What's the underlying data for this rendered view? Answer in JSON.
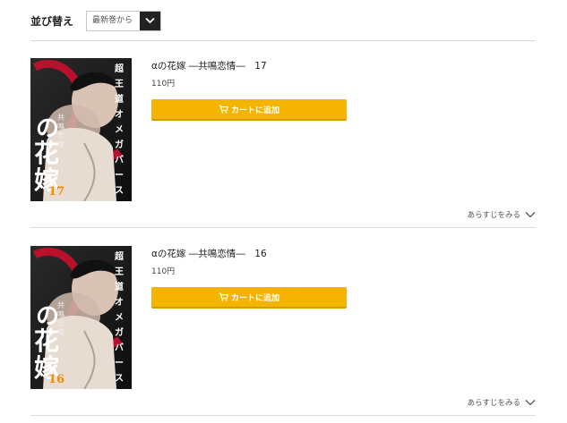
{
  "sort": {
    "label": "並び替え",
    "selected": "最新巻から"
  },
  "items": [
    {
      "title": "αの花嫁 ―共鳴恋情―　17",
      "price": "110円",
      "cart_label": "カートに追加",
      "synopsis_label": "あらすじをみる",
      "cover_volume": "17",
      "cover_title_chars": [
        "の",
        "花",
        "嫁"
      ],
      "cover_vertical_text": "超王道オメガバース",
      "cover_subtitle": "共鳴恋情"
    },
    {
      "title": "αの花嫁 ―共鳴恋情―　16",
      "price": "110円",
      "cart_label": "カートに追加",
      "synopsis_label": "あらすじをみる",
      "cover_volume": "16",
      "cover_title_chars": [
        "の",
        "花",
        "嫁"
      ],
      "cover_vertical_text": "超王道オメガバース",
      "cover_subtitle": "共鳴恋情"
    }
  ],
  "colors": {
    "cart_button": "#f5b400",
    "sort_button": "#222222",
    "divider": "#dcdcdc"
  },
  "icons": {
    "sort_toggle": "chevron-down-icon",
    "cart": "cart-icon",
    "synopsis": "chevron-down-icon"
  }
}
